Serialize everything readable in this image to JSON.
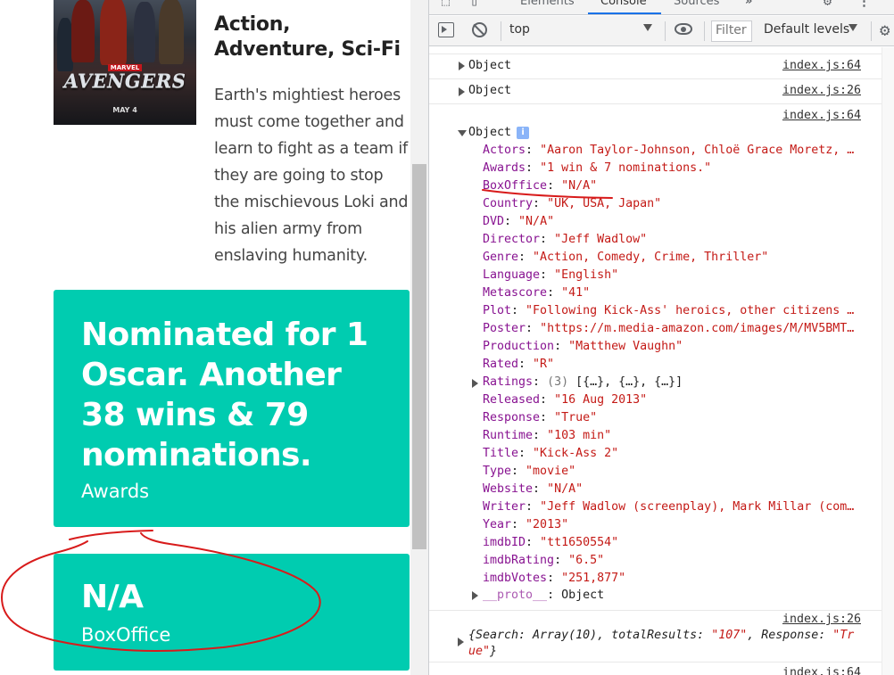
{
  "movie": {
    "poster": {
      "brand": "MARVEL",
      "title": "AVENGERS",
      "date": "MAY 4"
    },
    "genre": "Action, Adventure, Sci-Fi",
    "plot": "Earth's mightiest heroes must come together and learn to fight as a team if they are going to stop the mischievous Loki and his alien army from enslaving humanity.",
    "awards_card": {
      "value": "Nominated for 1 Oscar. Another 38 wins & 79 nominations.",
      "label": "Awards"
    },
    "boxoffice_card": {
      "value": "N/A",
      "label": "BoxOffice"
    },
    "accent_color": "#00ccb0"
  },
  "devtools": {
    "tabs": [
      "Elements",
      "Console",
      "Sources",
      "»"
    ],
    "active_tab": "Console",
    "toolbar": {
      "context": "top",
      "filter_placeholder": "Filter",
      "levels": "Default levels",
      "icons": [
        "sidebar-toggle-icon",
        "clear-console-icon",
        "eye-icon",
        "settings-icon"
      ]
    },
    "console": {
      "rows": [
        {
          "text": "Object",
          "source": "index.js:64"
        },
        {
          "text": "Object",
          "source": "index.js:26"
        }
      ],
      "expanded": {
        "source": "index.js:64",
        "header": "Object",
        "info_badge": "i",
        "props": [
          {
            "k": "Actors",
            "v": "\"Aaron Taylor-Johnson, Chloë Grace Moretz, …"
          },
          {
            "k": "Awards",
            "v": "\"1 win & 7 nominations.\""
          },
          {
            "k": "BoxOffice",
            "v": "\"N/A\""
          },
          {
            "k": "Country",
            "v": "\"UK, USA, Japan\""
          },
          {
            "k": "DVD",
            "v": "\"N/A\""
          },
          {
            "k": "Director",
            "v": "\"Jeff Wadlow\""
          },
          {
            "k": "Genre",
            "v": "\"Action, Comedy, Crime, Thriller\""
          },
          {
            "k": "Language",
            "v": "\"English\""
          },
          {
            "k": "Metascore",
            "v": "\"41\""
          },
          {
            "k": "Plot",
            "v": "\"Following Kick-Ass' heroics, other citizens …"
          },
          {
            "k": "Poster",
            "v": "\"https://m.media-amazon.com/images/M/MV5BMT…"
          },
          {
            "k": "Production",
            "v": "\"Matthew Vaughn\""
          },
          {
            "k": "Rated",
            "v": "\"R\""
          },
          {
            "k": "Ratings",
            "count": "(3)",
            "v": "[{…}, {…}, {…}]"
          },
          {
            "k": "Released",
            "v": "\"16 Aug 2013\""
          },
          {
            "k": "Response",
            "v": "\"True\""
          },
          {
            "k": "Runtime",
            "v": "\"103 min\""
          },
          {
            "k": "Title",
            "v": "\"Kick-Ass 2\""
          },
          {
            "k": "Type",
            "v": "\"movie\""
          },
          {
            "k": "Website",
            "v": "\"N/A\""
          },
          {
            "k": "Writer",
            "v": "\"Jeff Wadlow (screenplay), Mark Millar (com…"
          },
          {
            "k": "Year",
            "v": "\"2013\""
          },
          {
            "k": "imdbID",
            "v": "\"tt1650554\""
          },
          {
            "k": "imdbRating",
            "v": "\"6.5\""
          },
          {
            "k": "imdbVotes",
            "v": "\"251,877\""
          }
        ],
        "proto": {
          "k": "__proto__",
          "v": "Object"
        }
      },
      "search_row": {
        "source": "index.js:26",
        "line1_pre": "{Search: Array(10), totalResults: ",
        "total_results": "\"107\"",
        "line1_mid": ", Response: ",
        "response": "\"Tr",
        "line2": "ue\"",
        "line2_end": "}"
      },
      "last_source": "index.js:64"
    }
  },
  "annotation_color": "#d81b1b"
}
